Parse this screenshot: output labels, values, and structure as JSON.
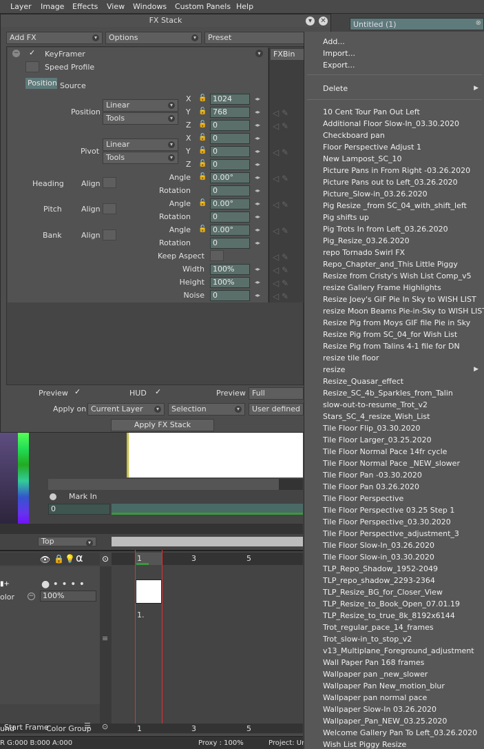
{
  "menubar": {
    "items": [
      "Layer",
      "Image",
      "Effects",
      "View",
      "Windows",
      "Custom Panels",
      "Help"
    ]
  },
  "fx": {
    "title": "FX Stack",
    "add_fx": "Add FX",
    "options": "Options",
    "preset": "Preset",
    "fxbin": "FXBin",
    "keyframer": "KeyFramer",
    "speed_profile": "Speed Profile",
    "tab_position": "Position",
    "tab_source": "Source",
    "position_label": "Position",
    "pivot_label": "Pivot",
    "linear": "Linear",
    "tools": "Tools",
    "x": "X",
    "y": "Y",
    "z": "Z",
    "pos_x": "1024",
    "pos_y": "768",
    "pos_z": "0",
    "piv_x": "0",
    "piv_y": "0",
    "piv_z": "0",
    "heading": "Heading",
    "pitch": "Pitch",
    "bank": "Bank",
    "align": "Align",
    "angle": "Angle",
    "rotation": "Rotation",
    "angle_val": "0.00°",
    "rotation_val": "0",
    "keep_aspect": "Keep Aspect",
    "width": "Width",
    "width_val": "100%",
    "height": "Height",
    "height_val": "100%",
    "noise": "Noise",
    "noise_val": "0",
    "preview": "Preview",
    "hud": "HUD",
    "preview2": "Preview",
    "preview_mode": "Full",
    "apply_on": "Apply on",
    "current_layer": "Current Layer",
    "selection": "Selection",
    "user_defined": "User defined",
    "apply_btn": "Apply FX Stack"
  },
  "untitled_tab": "Untitled (1)",
  "menu": {
    "top": [
      "Add...",
      "Import...",
      "Export..."
    ],
    "delete": "Delete",
    "items": [
      "10 Cent Tour Pan Out Left",
      "Additional Floor Slow-In_03.30.2020",
      "Checkboard pan",
      "Floor Perspective Adjust 1",
      "New Lampost_SC_10",
      "Picture Pans in From Right -03.26.2020",
      "Picture Pans out to Left_03.26.2020",
      "Picture_Slow-in_03.26.2020",
      "Pig Resize _from SC_04_with_shift_left",
      "Pig shifts up",
      "Pig Trots In from Left_03.26.2020",
      "Pig_Resize_03.26.2020",
      "repo Tornado Swirl FX",
      "Repo_Chapter_and_This Little Piggy",
      "Resize from Cristy's Wish List Comp_v5",
      "resize Gallery Frame Highlights",
      "Resize Joey's GIF  Pie In Sky to WISH LIST",
      "resize Moon Beams Pie-in-Sky to WISH LIST",
      "Resize Pig from Moys GIF file Pie in Sky",
      "Resize Pig from SC_04_for Wish List",
      "Resize Pig from Talins  4-1 file for DN",
      "resize tile floor",
      "resize",
      "Resize_Quasar_effect",
      "Resize_SC_4b_Sparkles_from_Talin",
      "slow-out-to-resume_Trot_v2",
      "Stars_SC_4_resize_Wish_List",
      "Tile Floor Flip_03.30.2020",
      "Tile Floor Larger_03.25.2020",
      "Tile Floor Normal Pace 14fr cycle",
      "Tile Floor Normal Pace _NEW_slower",
      "Tile Floor Pan -03.30.2020",
      "Tile Floor Pan 03.26.2020",
      "Tile Floor Perspective",
      "Tile Floor Perspective 03.25 Step 1",
      "Tile Floor Perspective_03.30.2020",
      "Tile Floor Perspective_adjustment_3",
      "Tile Floor Slow-In_03.26.2020",
      "Tile Floor Slow-in_03.30.2020",
      "TLP_Repo_Shadow_1952-2049",
      "TLP_repo_shadow_2293-2364",
      "TLP_Resize_BG_for_Closer_View",
      "TLP_Resize_to_Book_Open_07.01.19",
      "TLP_Resize_to_true_8k_8192x6144",
      "Trot_regular_pace_14_frames",
      "Trot_slow-in_to_stop_v2",
      "v13_Multiplane_Foreground_adjustment",
      "Wall Paper Pan 168 frames",
      "Wallpaper pan _new_slower",
      "Wallpaper Pan New_motion_blur",
      "Wallpaper pan normal pace",
      "Wallpaper Slow-In 03.26.2020",
      "Wallpaper_Pan_NEW_03.25.2020",
      "Welcome Gallery Pan To Left_03.26.2020",
      "Wish List Piggy Resize"
    ]
  },
  "bg": {
    "mark_in": "Mark In",
    "mark_in_val": "0",
    "top_label": "Top",
    "frame_nums": [
      "1",
      "3",
      "5"
    ],
    "opacity": "100%",
    "color_label": "olor",
    "frame_label": "1.",
    "round_label": "und",
    "color_group": "Color Group",
    "start_frame": "Start Frame",
    "status_rgb": "R G:000 B:000 A:000",
    "proxy": "Proxy : 100%",
    "project": "Project: Ur"
  }
}
